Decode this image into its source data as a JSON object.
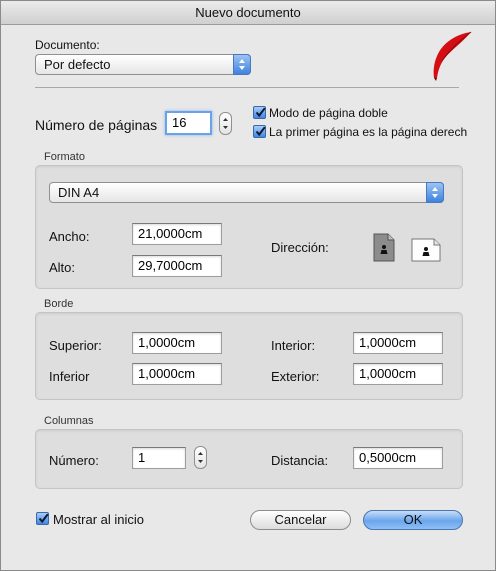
{
  "window": {
    "title": "Nuevo documento"
  },
  "document": {
    "label": "Documento:",
    "selected": "Por defecto"
  },
  "pages": {
    "label": "Número de páginas",
    "value": "16",
    "double_page_label": "Modo de página doble",
    "double_page_checked": true,
    "first_right_label": "La primer página es la página derech",
    "first_right_checked": true
  },
  "format": {
    "title": "Formato",
    "size": "DIN A4",
    "width_label": "Ancho:",
    "width_value": "21,0000cm",
    "height_label": "Alto:",
    "height_value": "29,7000cm",
    "orientation_label": "Dirección:",
    "orientation_options": [
      "portrait",
      "landscape"
    ],
    "orientation_selected": "portrait"
  },
  "border": {
    "title": "Borde",
    "top_label": "Superior:",
    "top_value": "1,0000cm",
    "bottom_label": "Inferior",
    "bottom_value": "1,0000cm",
    "inner_label": "Interior:",
    "inner_value": "1,0000cm",
    "outer_label": "Exterior:",
    "outer_value": "1,0000cm"
  },
  "columns": {
    "title": "Columnas",
    "number_label": "Número:",
    "number_value": "1",
    "distance_label": "Distancia:",
    "distance_value": "0,5000cm"
  },
  "footer": {
    "show_at_start_label": "Mostrar al inicio",
    "show_at_start_checked": true,
    "cancel_label": "Cancelar",
    "ok_label": "OK"
  },
  "colors": {
    "accent": "#3f86e2",
    "quill": "#d40f14"
  },
  "icons": [
    "quill-logo-icon",
    "popup-arrows-icon",
    "stepper-icon",
    "checkmark-icon",
    "portrait-page-icon",
    "landscape-page-icon"
  ]
}
